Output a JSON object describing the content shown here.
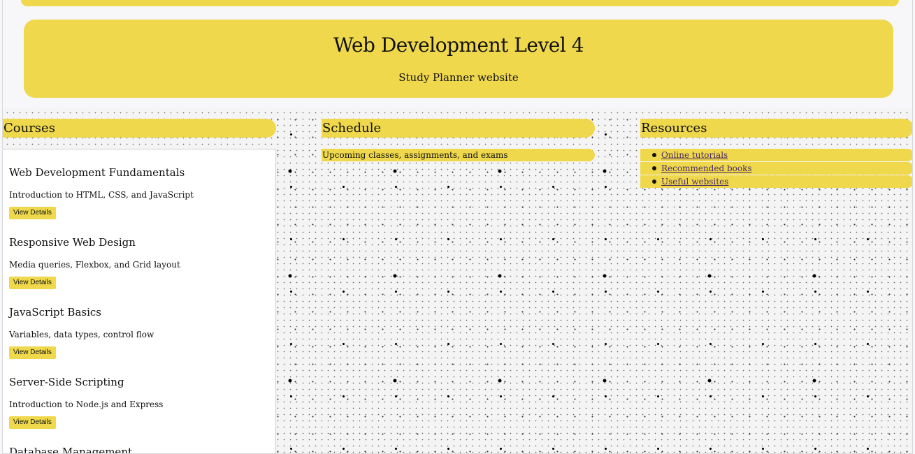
{
  "header": {
    "title": "Web Development Level 4",
    "subtitle": "Study Planner website"
  },
  "courses": {
    "heading": "Courses",
    "items": [
      {
        "title": "Web Development Fundamentals",
        "description": "Introduction to HTML, CSS, and JavaScript",
        "button": "View Details"
      },
      {
        "title": "Responsive Web Design",
        "description": "Media queries, Flexbox, and Grid layout",
        "button": "View Details"
      },
      {
        "title": "JavaScript Basics",
        "description": "Variables, data types, control flow",
        "button": "View Details"
      },
      {
        "title": "Server-Side Scripting",
        "description": "Introduction to Node.js and Express",
        "button": "View Details"
      },
      {
        "title": "Database Management",
        "description": "",
        "button": ""
      }
    ]
  },
  "schedule": {
    "heading": "Schedule",
    "items": [
      "Upcoming classes, assignments, and exams"
    ]
  },
  "resources": {
    "heading": "Resources",
    "links": [
      "Online tutorials",
      "Recommended books",
      "Useful websites"
    ]
  },
  "colors": {
    "accent": "#efd84c",
    "link": "#4a2a66",
    "background": "#f7f7f9"
  }
}
